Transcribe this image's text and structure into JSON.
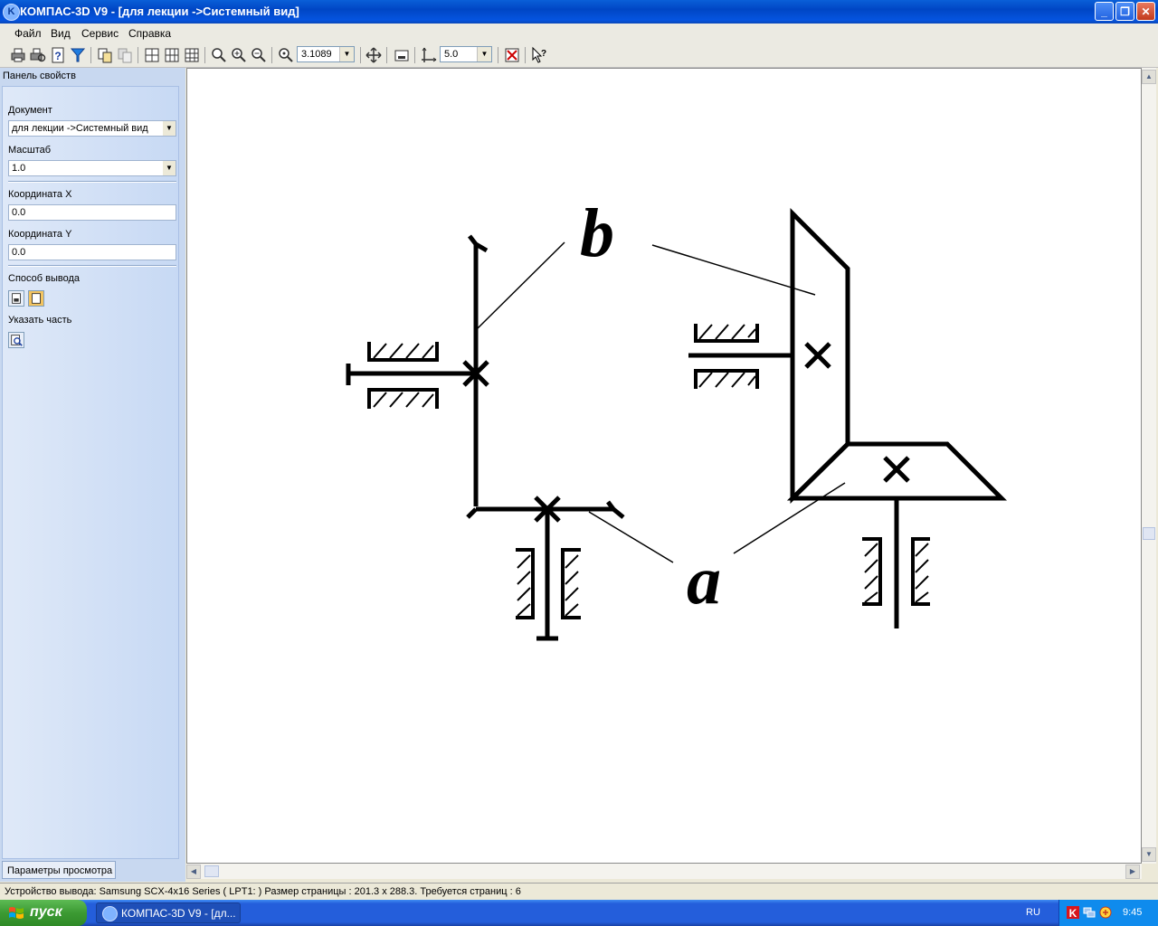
{
  "window": {
    "title": "КОМПАС-3D V9 - [для лекции ->Системный вид]",
    "app_icon_letter": "K"
  },
  "menu": [
    "Файл",
    "Вид",
    "Сервис",
    "Справка"
  ],
  "toolbar": {
    "zoom_value": "3.1089",
    "step_value": "5.0",
    "icons": [
      "print-icon",
      "print-preview-icon",
      "help-context-icon",
      "filter-icon",
      "copy-pages-icon",
      "paste-pages-icon",
      "page-layout-1-icon",
      "page-layout-2-icon",
      "page-layout-3-icon",
      "zoom-window-icon",
      "zoom-in-icon",
      "zoom-out-icon",
      "zoom-scale-icon",
      "pan-icon",
      "fit-page-icon",
      "snap-step-icon",
      "print-settings-icon",
      "whats-this-icon"
    ]
  },
  "panel": {
    "title": "Панель свойств",
    "document_label": "Документ",
    "document_value": "для лекции ->Системный вид",
    "scale_label": "Масштаб",
    "scale_value": "1.0",
    "coord_x_label": "Координата X",
    "coord_x_value": "0.0",
    "coord_y_label": "Координата Y",
    "coord_y_value": "0.0",
    "output_label": "Способ вывода",
    "part_label": "Указать часть",
    "tab_label": "Параметры просмотра"
  },
  "drawing": {
    "label_b": "b",
    "label_a": "a",
    "line_color": "#000000"
  },
  "status": {
    "text": "Устройство вывода: Samsung SCX-4x16 Series ( LPT1: )  Размер страницы : 201.3 x 288.3.  Требуется страниц : 6"
  },
  "taskbar": {
    "start_label": "пуск",
    "task_label": "КОМПАС-3D V9 - [дл...",
    "lang": "RU",
    "clock": "9:45"
  },
  "colors": {
    "titlebar": "#0a5fd8",
    "taskbar": "#245edb",
    "start": "#3c9a33",
    "panel": "#c8d8f0"
  }
}
